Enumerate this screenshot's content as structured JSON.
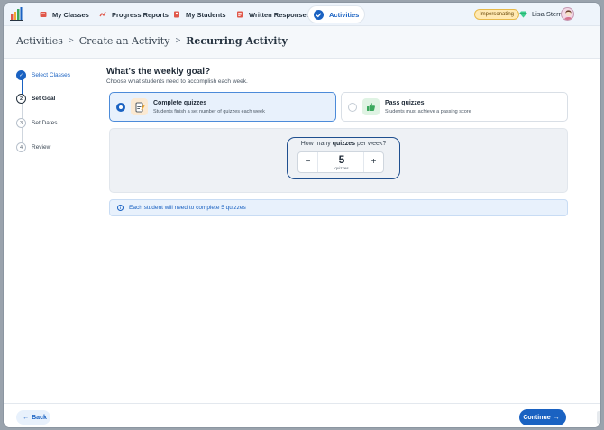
{
  "topnav": {
    "items": [
      {
        "label": "My Classes",
        "icon": "classes-icon",
        "color": "#e0574a"
      },
      {
        "label": "Progress Reports",
        "icon": "reports-icon",
        "color": "#e0574a"
      },
      {
        "label": "My Students",
        "icon": "students-icon",
        "color": "#e0574a"
      },
      {
        "label": "Written Responses",
        "icon": "written-responses-icon",
        "color": "#e0574a"
      },
      {
        "label": "Activities",
        "icon": "activities-icon",
        "active": true
      }
    ],
    "impersonating_badge": "Impersonating",
    "user_name": "Lisa Stern"
  },
  "breadcrumb": {
    "items": [
      "Activities",
      "Create an Activity",
      "Recurring Activity"
    ],
    "separator": ">"
  },
  "steps": [
    {
      "number": "✓",
      "label": "Select Classes",
      "state": "done"
    },
    {
      "number": "2",
      "label": "Set Goal",
      "state": "current"
    },
    {
      "number": "3",
      "label": "Set Dates",
      "state": "upcoming"
    },
    {
      "number": "4",
      "label": "Review",
      "state": "upcoming"
    }
  ],
  "main": {
    "title": "What's the weekly goal?",
    "subtitle": "Choose what students need to accomplish each week.",
    "options": [
      {
        "title": "Complete quizzes",
        "description": "Students finish a set number of quizzes each week",
        "selected": true,
        "icon": "quiz-checklist-icon"
      },
      {
        "title": "Pass quizzes",
        "description": "Students must achieve a passing score",
        "selected": false,
        "icon": "thumbs-up-icon"
      }
    ],
    "goal": {
      "question_prefix": "How many ",
      "question_bold": "quizzes",
      "question_suffix": " per week?",
      "minus": "−",
      "plus": "+",
      "value": "5",
      "unit": "quizzes"
    },
    "info": "Each student will need to complete 5 quizzes"
  },
  "footer": {
    "back": "Back",
    "continue": "Continue"
  },
  "colors": {
    "accent": "#1a62c2",
    "nav_bg": "#eef4fb",
    "badge_bg": "#ffe9b3"
  }
}
